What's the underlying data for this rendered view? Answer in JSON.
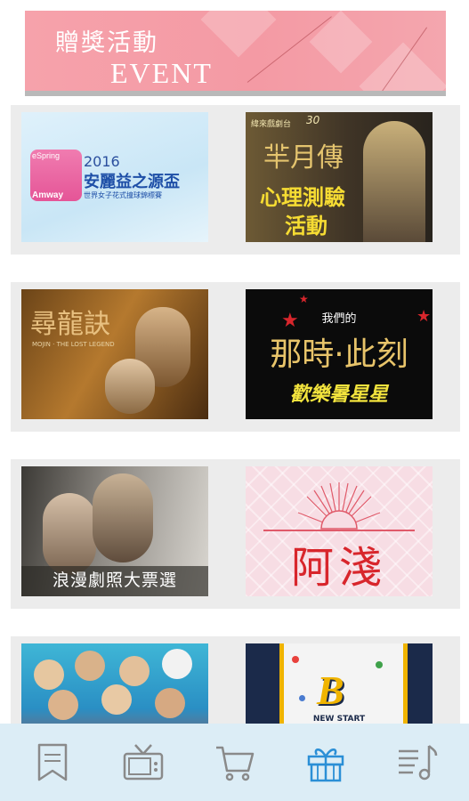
{
  "banner": {
    "title": "贈獎活動",
    "subtitle": "EVENT"
  },
  "events": [
    {
      "title": "安麗益之源盃",
      "year": "2016",
      "line2": "世界女子花式撞球錦標賽",
      "brand": "Amway",
      "tab": "eSpring"
    },
    {
      "title": "羋月傳",
      "line2": "心理測驗",
      "line3": "活動",
      "top": "緯來戲劇台",
      "top_num": "30"
    },
    {
      "title": "尋龍訣",
      "sub": "MOJIN · THE LOST LEGEND"
    },
    {
      "pre": "我們的",
      "title": "那時·此刻",
      "sub": "歡樂暑星星"
    },
    {
      "caption": "浪漫劇照大票選"
    },
    {
      "title": "阿淺"
    },
    {
      "title": ""
    },
    {
      "sub": "NEW START"
    }
  ],
  "nav": [
    {
      "name": "bookmark",
      "icon": "bookmark-icon",
      "active": false
    },
    {
      "name": "tv",
      "icon": "tv-icon",
      "active": false
    },
    {
      "name": "shopping-cart",
      "icon": "cart-icon",
      "active": false
    },
    {
      "name": "gift",
      "icon": "gift-icon",
      "active": true
    },
    {
      "name": "music",
      "icon": "music-list-icon",
      "active": false
    }
  ],
  "colors": {
    "active": "#2b8fd6",
    "inactive": "#8a8a8a",
    "nav_bg": "#dcedf6"
  }
}
